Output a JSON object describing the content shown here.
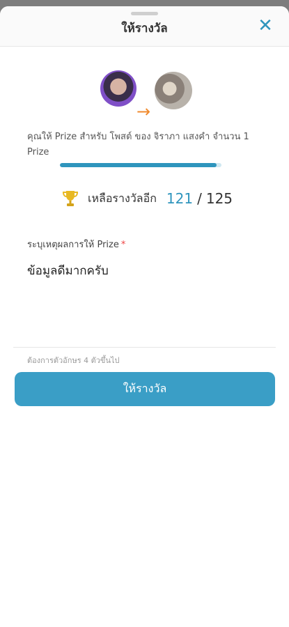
{
  "header": {
    "title": "ให้รางวัล",
    "close_icon": "close-icon"
  },
  "transfer": {
    "from_avatar": "avatar-giver",
    "to_avatar": "avatar-receiver",
    "arrow_icon": "arrow-right-icon",
    "description": "คุณให้ Prize สำหรับ โพสต์ ของ จิราภา แสงคำ จำนวน 1 Prize"
  },
  "progress": {
    "value_percent": 97
  },
  "remaining": {
    "icon": "trophy-icon",
    "label": "เหลือรางวัลอีก",
    "count": "121",
    "separator": "/",
    "total": "125"
  },
  "form": {
    "reason_label": "ระบุเหตุผลการให้ Prize",
    "required_mark": "*",
    "reason_value": "ข้อมูลดีมากครับ",
    "hint": "ต้องการตัวอักษร 4 ตัวขึ้นไป",
    "submit_label": "ให้รางวัล"
  },
  "colors": {
    "accent": "#3a9ec6",
    "arrow": "#f08a2d",
    "trophy": "#e8b923",
    "required": "#ee4444"
  }
}
